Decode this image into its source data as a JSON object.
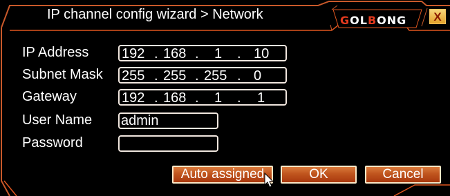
{
  "window": {
    "title": "IP channel config wizard > Network"
  },
  "logo": {
    "text_a": "G",
    "text_b": "OL",
    "text_c": "B",
    "text_d": "ONG"
  },
  "close": {
    "label": "X"
  },
  "fields": {
    "ip": {
      "label": "IP Address",
      "seg": [
        "192",
        "168",
        "1",
        "10"
      ]
    },
    "mask": {
      "label": "Subnet Mask",
      "seg": [
        "255",
        "255",
        "255",
        "0"
      ]
    },
    "gateway": {
      "label": "Gateway",
      "seg": [
        "192",
        "168",
        "1",
        "1"
      ]
    },
    "user": {
      "label": "User Name",
      "value": "admin"
    },
    "password": {
      "label": "Password",
      "value": ""
    }
  },
  "dot": ".",
  "buttons": {
    "auto": "Auto assigned",
    "ok": "OK",
    "cancel": "Cancel"
  },
  "colors": {
    "accent": "#e0561f",
    "border": "#f1e7df",
    "background": "#000000"
  }
}
